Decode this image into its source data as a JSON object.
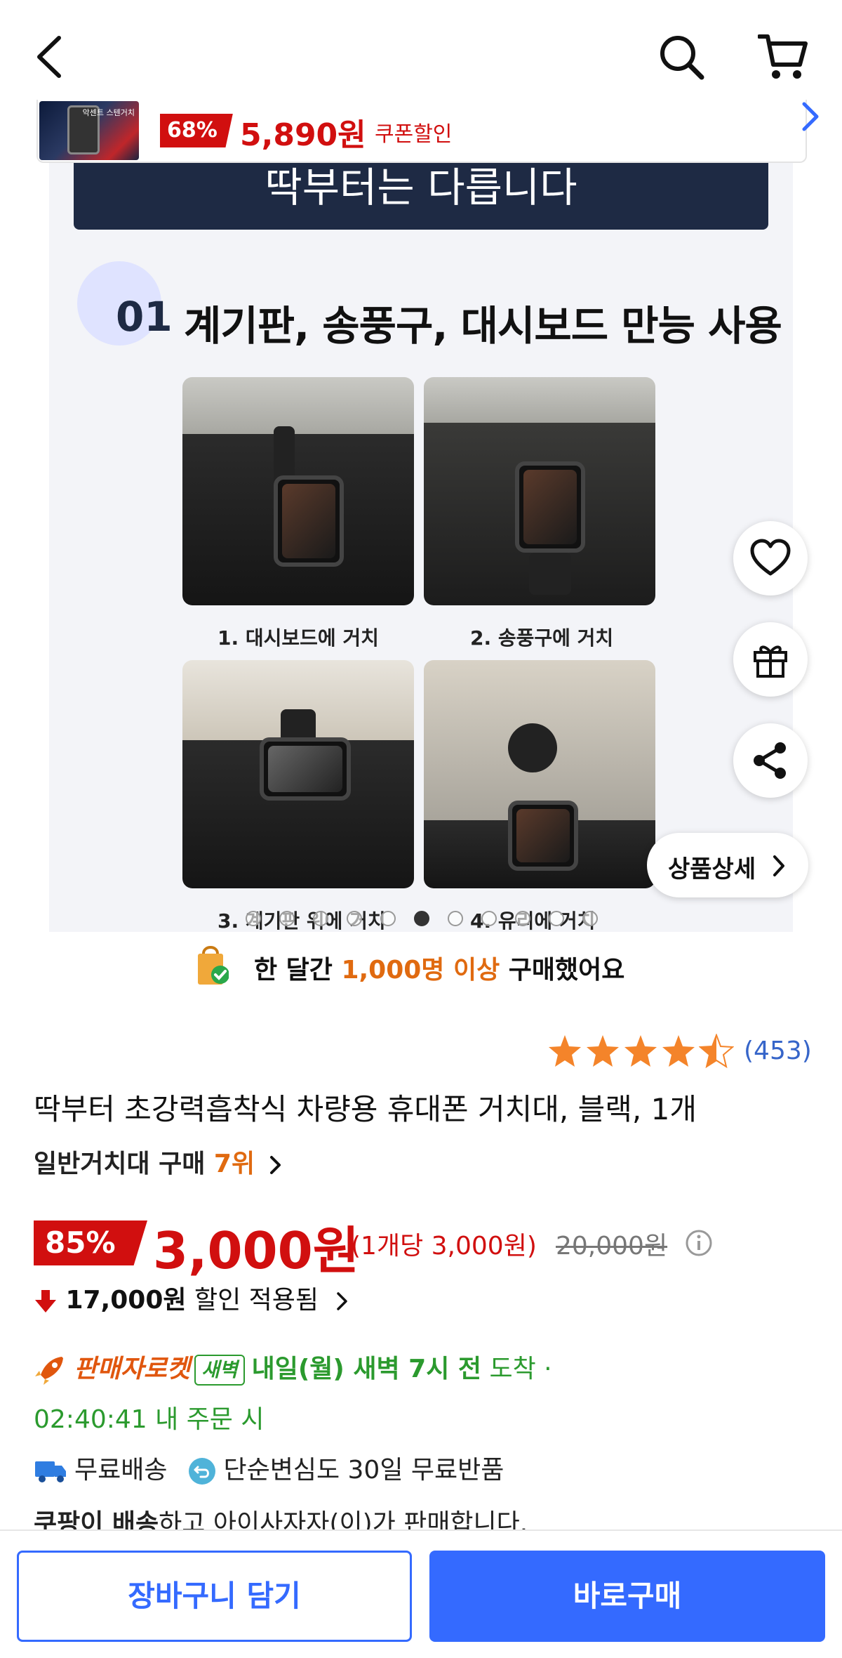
{
  "coupon": {
    "thumb_text": "악센트 스텐거치",
    "discount": "68%",
    "price": "5,890원",
    "label": "쿠폰할인"
  },
  "hero": {
    "header": "딱부터는 다릅니다",
    "feature_number": "01",
    "feature_title": "계기판, 송풍구, 대시보드 만능 사용",
    "captions": [
      "1. 대시보드에 거치",
      "2. 송풍구에 거치",
      "3. 계기판 위에 거치",
      "4. 유리에 거치"
    ],
    "slide_count": 11,
    "active_slide": 5
  },
  "floating": {
    "detail_label": "상품상세"
  },
  "purchased": {
    "prefix": "한 달간 ",
    "highlight": "1,000명 이상",
    "suffix": " 구매했어요"
  },
  "rating": {
    "stars": 4.5,
    "count": "(453)"
  },
  "product": {
    "title": "딱부터 초강력흡착식 차량용 휴대폰 거치대, 블랙, 1개",
    "rank_prefix": "일반거치대 구매 ",
    "rank_value": "7위"
  },
  "price": {
    "discount": "85%",
    "sale": "3,000원",
    "unit": "(1개당 3,000원)",
    "original": "20,000원",
    "saved_amount": "17,000원",
    "saved_label": "할인 적용됨"
  },
  "delivery": {
    "seller_rocket": "판매자로켓",
    "dawn_badge": "새벽",
    "eta_bold": "내일(월) 새벽 7시 전",
    "eta_suffix": " 도착 ·",
    "countdown": "02:40:41 내 주문 시",
    "free_shipping": "무료배송",
    "free_return": "단순변심도 30일 무료반품",
    "sold_by_bold": "쿠팡이 배송",
    "sold_by_rest": "하고 아이사자자(이)가 판매합니다."
  },
  "actions": {
    "add_to_cart": "장바구니 담기",
    "buy_now": "바로구매"
  },
  "colors": {
    "brand_blue": "#346aff",
    "sale_red": "#d10f0f",
    "accent_orange": "#e06a10",
    "delivery_green": "#2b9a2e"
  },
  "icons": [
    "back-icon",
    "search-icon",
    "cart-icon",
    "chevron-right-icon",
    "heart-icon",
    "gift-icon",
    "share-icon",
    "info-icon",
    "arrow-down-icon",
    "rocket-icon",
    "truck-icon",
    "return-icon",
    "shopping-bag-icon",
    "star-icon"
  ]
}
